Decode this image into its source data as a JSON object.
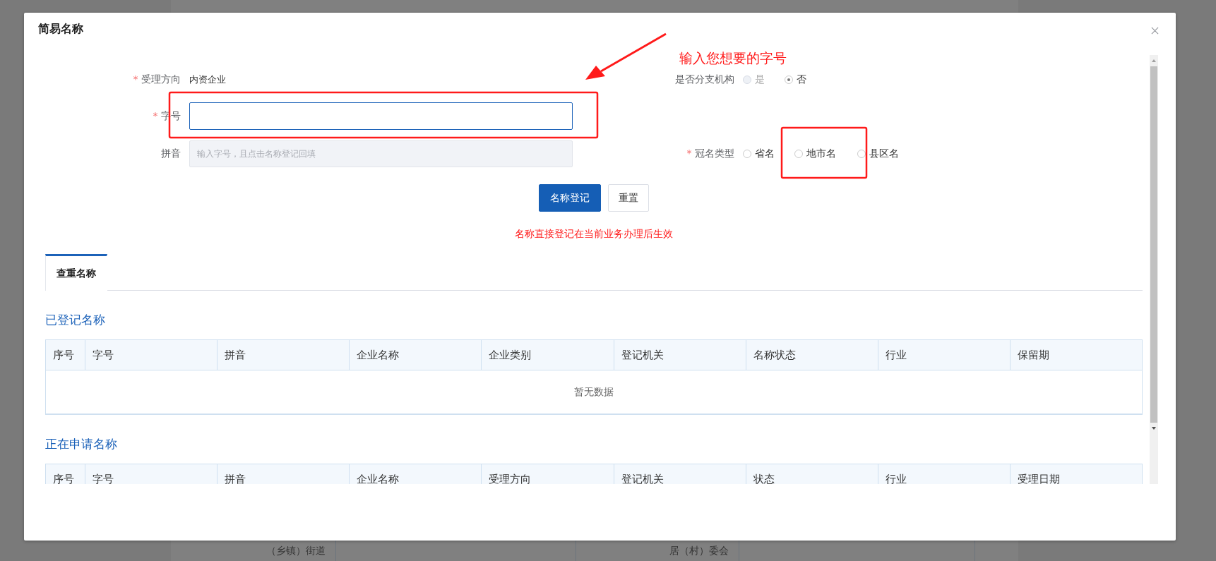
{
  "background_page": {
    "cells": [
      "（乡镇）街道",
      "居（村）委会"
    ]
  },
  "dialog": {
    "title": "简易名称"
  },
  "form": {
    "rows": [
      {
        "fields": [
          {
            "kind": "text",
            "label": "受理方向",
            "required_mark": "*",
            "value": "内资企业"
          },
          {
            "kind": "radios",
            "label": "是否分支机构",
            "options": [
              {
                "label": "是",
                "selected": false,
                "disabled": true
              },
              {
                "label": "否",
                "selected": true,
                "disabled": false
              }
            ]
          }
        ]
      },
      {
        "fields": [
          {
            "kind": "input",
            "label": "字号",
            "required_mark": "*",
            "focused": true,
            "disabled": false
          }
        ]
      },
      {
        "fields": [
          {
            "kind": "input",
            "label": "拼音",
            "placeholder": "输入字号，且点击名称登记回填",
            "focused": false,
            "disabled": true
          },
          {
            "kind": "radios",
            "label": "冠名类型",
            "required_mark": "*",
            "options": [
              {
                "label": "省名",
                "selected": false,
                "disabled": false
              },
              {
                "label": "地市名",
                "selected": false,
                "disabled": false
              },
              {
                "label": "县区名",
                "selected": false,
                "disabled": false
              }
            ]
          }
        ]
      }
    ]
  },
  "buttons": [
    {
      "label": "名称登记",
      "primary": true
    },
    {
      "label": "重置",
      "primary": false
    }
  ],
  "notice": "名称直接登记在当前业务办理后生效",
  "tabs": [
    {
      "label": "查重名称",
      "selected": true
    }
  ],
  "sections": [
    {
      "title": "已登记名称",
      "columns": [
        "序号",
        "字号",
        "拼音",
        "企业名称",
        "企业类别",
        "登记机关",
        "名称状态",
        "行业",
        "保留期"
      ],
      "empty_text": "暂无数据"
    },
    {
      "title": "正在申请名称",
      "columns": [
        "序号",
        "字号",
        "拼音",
        "企业名称",
        "受理方向",
        "登记机关",
        "状态",
        "行业",
        "受理日期"
      ]
    }
  ],
  "annotation": {
    "text": "输入您想要的字号"
  }
}
